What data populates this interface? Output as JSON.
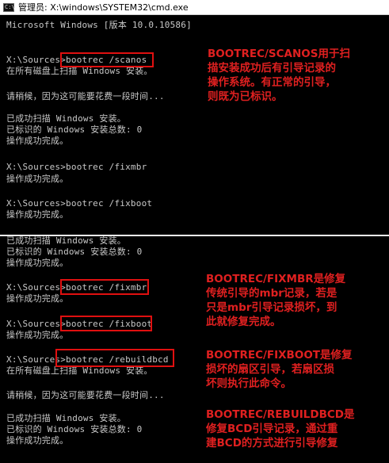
{
  "window": {
    "icon_text": "C:\\",
    "title": "管理员: X:\\windows\\SYSTEM32\\cmd.exe"
  },
  "pane1": {
    "lines": [
      "Microsoft Windows [版本 10.0.10586]",
      "X:\\Sources>bootrec /scanos",
      "在所有磁盘上扫描 Windows 安装。",
      "请稍候，因为这可能要花费一段时间...",
      "已成功扫描 Windows 安装。",
      "已标识的 Windows 安装总数: 0",
      "操作成功完成。",
      "X:\\Sources>bootrec /fixmbr",
      "操作成功完成。",
      "X:\\Sources>bootrec /fixboot",
      "操作成功完成。"
    ],
    "note_scanos": "BOOTREC/SCANOS用于扫\n描安装成功后有引导记录的\n操作系统。有正常的引导，\n则既为已标识。"
  },
  "pane2": {
    "lines": [
      "已成功扫描 Windows 安装。",
      "已标识的 Windows 安装总数: 0",
      "操作成功完成。",
      "X:\\Sources>bootrec /fixmbr",
      "操作成功完成。",
      "X:\\Sources>bootrec /fixboot",
      "操作成功完成。",
      "X:\\Sources>bootrec /rebuildbcd",
      "在所有磁盘上扫描 Windows 安装。",
      "请稍候，因为这可能要花费一段时间...",
      "已成功扫描 Windows 安装。",
      "已标识的 Windows 安装总数: 0",
      "操作成功完成。"
    ],
    "note_fixmbr": "BOOTREC/FIXMBR是修复\n传统引导的mbr记录，若是\n只是mbr引导记录损坏，到\n此就修复完成。",
    "note_fixboot": "BOOTREC/FIXBOOT是修复\n损坏的扇区引导，若扇区损\n坏则执行此命令。",
    "note_rebuildbcd": "BOOTREC/REBUILDBCD是\n修复BCD引导记录，通过重\n建BCD的方式进行引导修复"
  },
  "colors": {
    "console_bg": "#000000",
    "console_text": "#c8c8c8",
    "annotation": "#e02020"
  }
}
